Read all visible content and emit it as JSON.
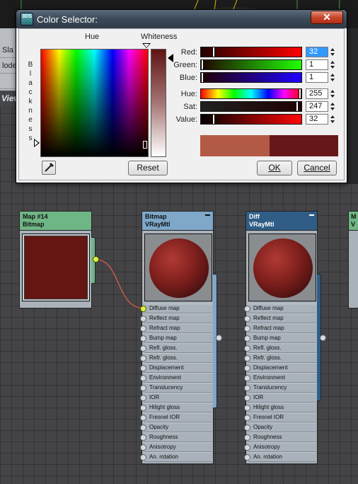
{
  "dialog": {
    "title": "Color Selector:",
    "app_icon_text": "3DS",
    "close_label": "✕",
    "hue_label": "Hue",
    "whiteness_label": "Whiteness",
    "blackness_label": "Blackness",
    "sliders": [
      {
        "label": "Red:",
        "value": "32",
        "active": true,
        "position": 0.125
      },
      {
        "label": "Green:",
        "value": "1",
        "active": false,
        "position": 0.004
      },
      {
        "label": "Blue:",
        "value": "1",
        "active": false,
        "position": 0.004
      },
      {
        "label": "Hue:",
        "value": "255",
        "active": false,
        "position": 1.0
      },
      {
        "label": "Sat:",
        "value": "247",
        "active": false,
        "position": 0.969
      },
      {
        "label": "Value:",
        "value": "32",
        "active": false,
        "position": 0.125
      }
    ],
    "new_color": "#b25a46",
    "old_color": "#661818",
    "reset_label": "Reset",
    "ok_label": "OK",
    "cancel_label": "Cancel",
    "eyedropper_icon": "eyedropper-icon"
  },
  "background": {
    "menu_items": [
      "Sla",
      "lode",
      ""
    ],
    "view_label": "View"
  },
  "nodes": [
    {
      "title": "Map #14",
      "subtitle": "Bitmap",
      "header_color": "#6fb685",
      "preview_color": "#661612"
    },
    {
      "title": "Bitmap",
      "subtitle": "VRayMtl",
      "header_color": "#7ea7c9"
    },
    {
      "title": "Diff",
      "subtitle": "VRayMtl",
      "header_color": "#2f5d86"
    },
    {
      "title": "M",
      "subtitle": "V",
      "header_color": "#6fb685"
    }
  ],
  "vray_slots": [
    "Diffuse map",
    "Reflect map",
    "Refract map",
    "Bump map",
    "Refl. gloss.",
    "Refr. gloss.",
    "Displacement",
    "Environment",
    "Translucency",
    "IOR",
    "Hilight gloss",
    "Fresnel IOR",
    "Opacity",
    "Roughness",
    "Anisotropy",
    "An. rotation"
  ],
  "colors": {
    "wire": "#e8594a",
    "active_socket": "#dcf23a"
  }
}
